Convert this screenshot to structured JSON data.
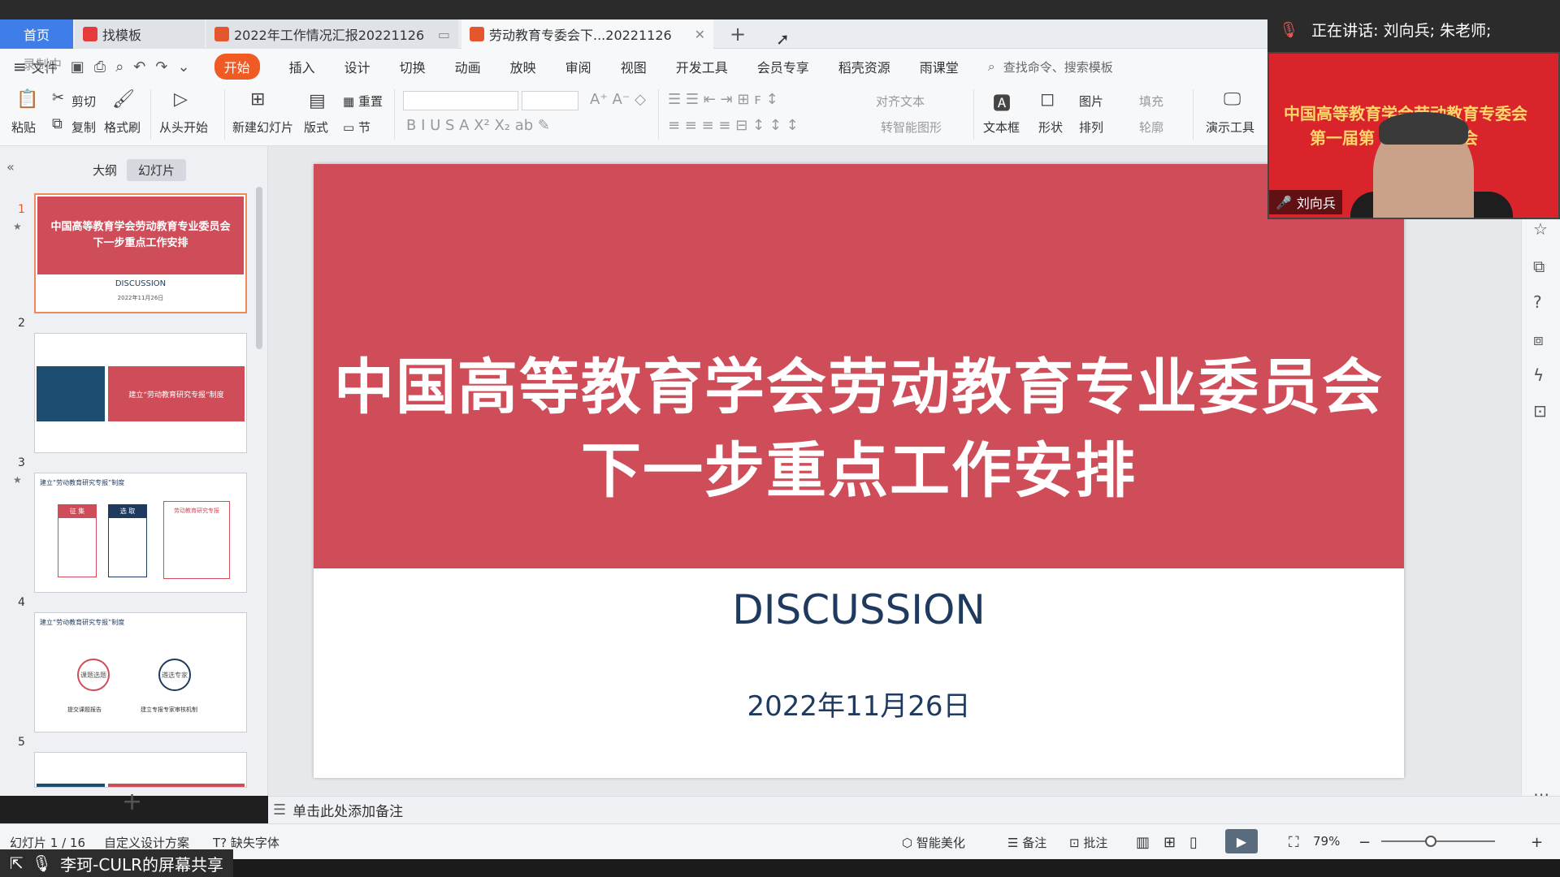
{
  "tabs": {
    "home": "首页",
    "t1": "找模板",
    "t2": "2022年工作情况汇报20221126",
    "t3": "劳动教育专委会下...20221126"
  },
  "menu": {
    "file": "文件",
    "items": [
      "开始",
      "插入",
      "设计",
      "切换",
      "动画",
      "放映",
      "审阅",
      "视图",
      "开发工具",
      "会员专享",
      "稻壳资源",
      "雨课堂"
    ],
    "search": "查找命令、搜索模板",
    "record": "录制中"
  },
  "ribbon": {
    "paste": "粘贴",
    "cut": "剪切",
    "copy": "复制",
    "format_painter": "格式刷",
    "from_start": "从头开始",
    "new_slide": "新建幻灯片",
    "layout": "版式",
    "reset": "重置",
    "section": "节",
    "align_text": "对齐文本",
    "convert_smartart": "转智能图形",
    "textbox": "文本框",
    "shape": "形状",
    "picture": "图片",
    "arrange": "排列",
    "fill": "填充",
    "outline": "轮廓",
    "present_tools": "演示工具"
  },
  "panel": {
    "outline_tab": "大纲",
    "slides_tab": "幻灯片",
    "numbers": [
      "1",
      "2",
      "3",
      "4",
      "5"
    ]
  },
  "thumbs": {
    "s1_line1": "中国高等教育学会劳动教育专业委员会",
    "s1_line2": "下一步重点工作安排",
    "s1_sub": "DISCUSSION",
    "s1_date": "2022年11月26日",
    "s2_text": "建立“劳动教育研究专报”制度",
    "s3_header": "建立“劳动教育研究专报”制度",
    "s3_box1": "征 集",
    "s3_box2": "选 取",
    "s3_box3": "劳动教育研究专报",
    "s4_header": "建立“劳动教育研究专报”制度",
    "s4_c1": "课题选题",
    "s4_c2": "遴选专家",
    "s4_l1": "提交课题报告",
    "s4_l2": "建立专报专家审核机制"
  },
  "slide": {
    "title_line1": "中国高等教育学会劳动教育专业委员会",
    "title_line2": "下一步重点工作安排",
    "subtitle": "DISCUSSION",
    "date": "2022年11月26日"
  },
  "notes": {
    "placeholder": "单击此处添加备注"
  },
  "status": {
    "slide_count": "幻灯片 1 / 16",
    "design": "自定义设计方案",
    "missing_font": "缺失字体",
    "beautify": "智能美化",
    "notes": "备注",
    "comment": "批注",
    "zoom": "79%"
  },
  "share": {
    "label": "李珂-CULR的屏幕共享"
  },
  "video": {
    "speaking": "正在讲话: 刘向兵; 朱老师;",
    "banner_line1": "中国高等教育学会劳动教育专委会",
    "banner_line2": "第一届第  次主任办公会",
    "name": "刘向兵"
  },
  "colors": {
    "slide_red": "#cf4d59",
    "navy": "#1e3a5f",
    "accent_orange": "#f05a24",
    "home_tab": "#3f7de8"
  }
}
